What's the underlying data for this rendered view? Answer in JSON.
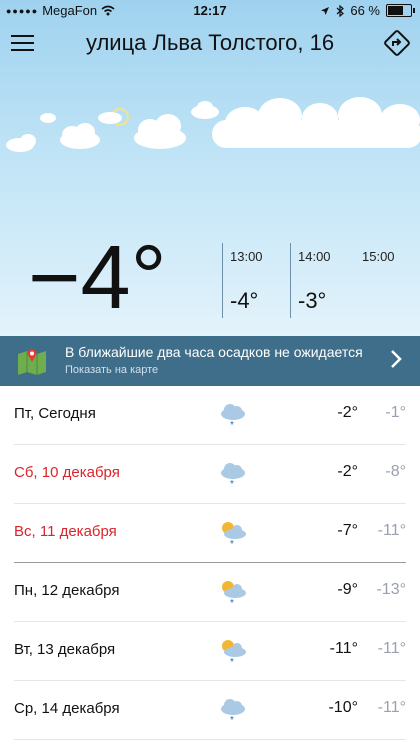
{
  "status_bar": {
    "carrier": "MegaFon",
    "time": "12:17",
    "battery": "66 %",
    "battery_level": 0.66,
    "icons": [
      "signal-dots-icon",
      "wifi-icon",
      "location-arrow-icon",
      "bluetooth-icon",
      "battery-icon"
    ]
  },
  "header": {
    "title": "улица Льва Толстого, 16",
    "menu_icon": "hamburger-menu-icon",
    "route_icon": "route-sign-icon"
  },
  "current": {
    "temperature": "−4°"
  },
  "hourly": [
    {
      "hour": "13:00",
      "temp": "-4°"
    },
    {
      "hour": "14:00",
      "temp": "-3°"
    },
    {
      "hour": "15:00",
      "temp": ""
    }
  ],
  "precipitation": {
    "message": "В ближайшие два часа осадков не ожидается",
    "link": "Показать на карте"
  },
  "colors": {
    "banner_bg": "#3f6e8a",
    "weekend_red": "#d8262c",
    "night_temp": "#9aa0b0"
  },
  "days": [
    {
      "label": "Пт, Сегодня",
      "icon": "cloud-snow-icon",
      "day_temp": "-2°",
      "night_temp": "-1°",
      "weekend": false
    },
    {
      "label": "Сб, 10 декабря",
      "icon": "cloud-snow-icon",
      "day_temp": "-2°",
      "night_temp": "-8°",
      "weekend": true
    },
    {
      "label": "Вс, 11 декабря",
      "icon": "sun-cloud-snow-icon",
      "day_temp": "-7°",
      "night_temp": "-11°",
      "weekend": true
    },
    {
      "label": "Пн, 12 декабря",
      "icon": "sun-cloud-snow-icon",
      "day_temp": "-9°",
      "night_temp": "-13°",
      "weekend": false
    },
    {
      "label": "Вт, 13 декабря",
      "icon": "sun-cloud-snow-icon",
      "day_temp": "-11°",
      "night_temp": "-11°",
      "weekend": false
    },
    {
      "label": "Ср, 14 декабря",
      "icon": "cloud-snow-icon",
      "day_temp": "-10°",
      "night_temp": "-11°",
      "weekend": false
    }
  ]
}
